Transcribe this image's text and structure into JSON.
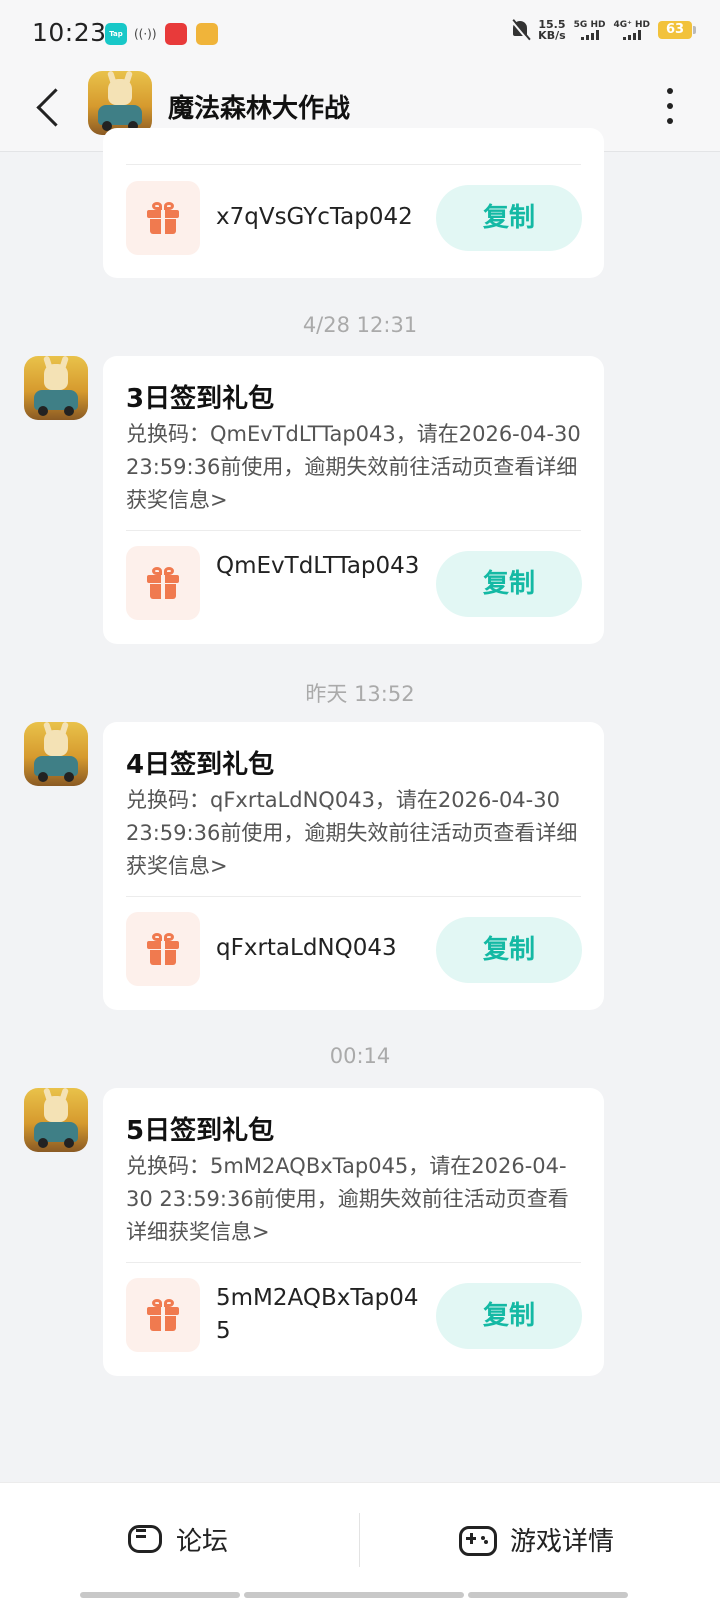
{
  "status_bar": {
    "time": "10:23",
    "tap_icon_label": "Tap",
    "net_speed_value": "15.5",
    "net_speed_unit": "KB/s",
    "sim1_label": "5G HD",
    "sim2_label": "4G⁺ HD",
    "battery_level": "63",
    "icons": [
      "taptap-icon",
      "hotspot-icon",
      "app-notification-icon",
      "app-notification-icon",
      "mute-bell-icon",
      "signal-icon",
      "battery-icon"
    ]
  },
  "nav": {
    "title": "魔法森林大作战",
    "back_icon": "chevron-left-icon",
    "more_icon": "more-vertical-icon"
  },
  "messages": [
    {
      "timestamp": "",
      "title": "",
      "description": "",
      "code": "x7qVsGYcTap042",
      "copy_label": "复制"
    },
    {
      "timestamp": "4/28  12:31",
      "title": "3日签到礼包",
      "description": "兑换码：QmEvTdLTTap043，请在2026-04-30 23:59:36前使用，逾期失效前往活动页查看详细获奖信息>",
      "code": "QmEvTdLTTap043",
      "copy_label": "复制"
    },
    {
      "timestamp": "昨天  13:52",
      "title": "4日签到礼包",
      "description": "兑换码：qFxrtaLdNQ043，请在2026-04-30 23:59:36前使用，逾期失效前往活动页查看详细获奖信息>",
      "code": "qFxrtaLdNQ043",
      "copy_label": "复制"
    },
    {
      "timestamp": "00:14",
      "title": "5日签到礼包",
      "description": "兑换码：5mM2AQBxTap045，请在2026-04-30 23:59:36前使用，逾期失效前往活动页查看详细获奖信息>",
      "code": "5mM2AQBxTap045",
      "copy_label": "复制"
    }
  ],
  "bottom_bar": {
    "forum_label": "论坛",
    "forum_icon": "chat-bubble-icon",
    "detail_label": "游戏详情",
    "detail_icon": "gamepad-icon"
  },
  "colors": {
    "accent": "#14b9a4",
    "copy_button_bg": "#e2f7f4",
    "gift_icon": "#f07a4f",
    "gift_bg": "#fdf0eb",
    "page_bg": "#f2f3f5"
  }
}
